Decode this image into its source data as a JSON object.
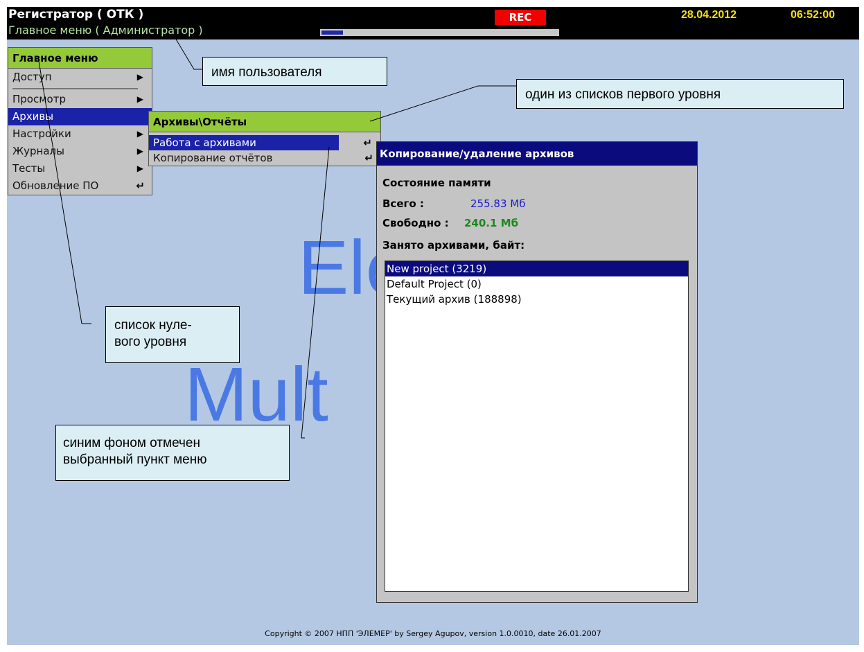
{
  "topbar": {
    "title": "Регистратор ( ОТК )",
    "subtitle": "Главное меню ( Администратор )",
    "rec": "REC",
    "date": "28.04.2012",
    "time": "06:52:00",
    "progress_fraction": 0.09
  },
  "background_logo": {
    "line1": "Ele",
    "line2": "Mult"
  },
  "main_menu": {
    "header": "Главное меню",
    "items": [
      {
        "label": "Доступ",
        "icon": "arrow-right-icon"
      },
      {
        "label": "Просмотр",
        "icon": "arrow-right-icon"
      },
      {
        "label": "Архивы",
        "icon": "arrow-right-icon",
        "selected": true
      },
      {
        "label": "Настройки",
        "icon": "arrow-right-icon"
      },
      {
        "label": "Журналы",
        "icon": "arrow-right-icon"
      },
      {
        "label": "Тесты",
        "icon": "arrow-right-icon"
      },
      {
        "label": "Обновление ПО",
        "icon": "enter-icon"
      }
    ]
  },
  "archives_menu": {
    "header": "Архивы\\Отчёты",
    "items": [
      {
        "label": "Работа с архивами",
        "icon": "enter-icon",
        "selected": true
      },
      {
        "label": "Копирование отчётов",
        "icon": "enter-icon"
      }
    ]
  },
  "dialog": {
    "title": "Копирование/удаление архивов",
    "memory_title": "Состояние памяти",
    "total_label": "Всего :",
    "total_value": "255.83 Мб",
    "free_label": "Свободно :",
    "free_value": "240.1 Мб",
    "occupied_label": "Занято архивами, байт:",
    "archives": [
      "New project (3219)",
      "Default Project (0)",
      "Текущий архив (188898)"
    ]
  },
  "annotations": {
    "user_name": "имя пользователя",
    "first_level": "один из списков первого уровня",
    "zero_level": "список нуле-\nвого уровня",
    "selected_item": "синим фоном отмечен\nвыбранный пункт меню"
  },
  "copyright": "Copyright © 2007 НПП 'ЭЛЕМЕР' by Sergey Agupov, version 1.0.0010, date 26.01.2007",
  "colors": {
    "screen_bg": "#b4c8e4",
    "menu_header": "#94c93a",
    "selection": "#1a22a8",
    "rec": "#f10000",
    "clock": "#f7e20d",
    "total_value": "#1a1ad0",
    "free_value": "#1a8a1a"
  }
}
